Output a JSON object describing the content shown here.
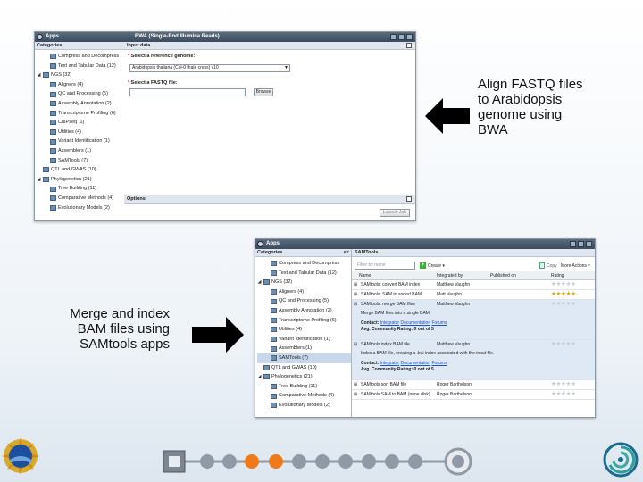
{
  "top_shot": {
    "apps_title": "Apps",
    "dialog_title": "BWA (Single-End Illumina Reads)",
    "categories_header": "Categories",
    "tree": [
      {
        "exp": "",
        "label": "Compress and Decompress",
        "indent": 1
      },
      {
        "exp": "",
        "label": "Text and Tabular Data (12)",
        "indent": 1
      },
      {
        "exp": "◢",
        "label": "NGS (32)",
        "indent": 0
      },
      {
        "exp": "",
        "label": "Aligners (4)",
        "indent": 1
      },
      {
        "exp": "",
        "label": "QC and Processing (5)",
        "indent": 1
      },
      {
        "exp": "",
        "label": "Assembly Annotation (2)",
        "indent": 1
      },
      {
        "exp": "",
        "label": "Transcriptome Profiling (6)",
        "indent": 1
      },
      {
        "exp": "",
        "label": "ChIPseq (1)",
        "indent": 1
      },
      {
        "exp": "",
        "label": "Utilities (4)",
        "indent": 1
      },
      {
        "exp": "",
        "label": "Variant Identification (1)",
        "indent": 1
      },
      {
        "exp": "",
        "label": "Assemblers (1)",
        "indent": 1
      },
      {
        "exp": "",
        "label": "SAMTools (7)",
        "indent": 1
      },
      {
        "exp": "",
        "label": "QTL and GWAS (10)",
        "indent": 0
      },
      {
        "exp": "◢",
        "label": "Phylogenetics (21)",
        "indent": 0
      },
      {
        "exp": "",
        "label": "Tree Building (11)",
        "indent": 1
      },
      {
        "exp": "",
        "label": "Comparative Methods (4)",
        "indent": 1
      },
      {
        "exp": "",
        "label": "Evolutionary Models (2)",
        "indent": 1
      }
    ],
    "input_header": "Input data",
    "ref_label": "Select a reference genome:",
    "ref_value": "Arabidopsis thaliana (Col-0 thale cress) v10",
    "fastq_label": "Select a FASTQ file:",
    "browse_label": "Browse",
    "options_header": "Options",
    "launch_label": "Launch Job"
  },
  "bottom_shot": {
    "apps_title": "Apps",
    "categories_header": "Categories",
    "collapse_label": "<<",
    "tree": [
      {
        "exp": "",
        "label": "Compress and Decompress",
        "indent": 1,
        "sel": false
      },
      {
        "exp": "",
        "label": "Text and Tabular Data (12)",
        "indent": 1,
        "sel": false
      },
      {
        "exp": "◢",
        "label": "NGS (32)",
        "indent": 0,
        "sel": false
      },
      {
        "exp": "",
        "label": "Aligners (4)",
        "indent": 1,
        "sel": false
      },
      {
        "exp": "",
        "label": "QC and Processing (5)",
        "indent": 1,
        "sel": false
      },
      {
        "exp": "",
        "label": "Assembly Annotation (2)",
        "indent": 1,
        "sel": false
      },
      {
        "exp": "",
        "label": "Transcriptome Profiling (6)",
        "indent": 1,
        "sel": false
      },
      {
        "exp": "",
        "label": "Utilities (4)",
        "indent": 1,
        "sel": false
      },
      {
        "exp": "",
        "label": "Variant Identification (1)",
        "indent": 1,
        "sel": false
      },
      {
        "exp": "",
        "label": "Assemblers (1)",
        "indent": 1,
        "sel": false
      },
      {
        "exp": "",
        "label": "SAMTools (7)",
        "indent": 1,
        "sel": true
      },
      {
        "exp": "",
        "label": "QTL and GWAS (10)",
        "indent": 0,
        "sel": false
      },
      {
        "exp": "◢",
        "label": "Phylogenetics (21)",
        "indent": 0,
        "sel": false
      },
      {
        "exp": "",
        "label": "Tree Building (11)",
        "indent": 1,
        "sel": false
      },
      {
        "exp": "",
        "label": "Comparative Methods (4)",
        "indent": 1,
        "sel": false
      },
      {
        "exp": "",
        "label": "Evolutionary Models (2)",
        "indent": 1,
        "sel": false
      }
    ],
    "panel_title": "SAMTools",
    "filter_placeholder": "Filter by name",
    "create_label": "Create ▾",
    "copy_label": "Copy",
    "more_actions_label": "More Actions ▾",
    "columns": {
      "name": "Name",
      "integrated_by": "Integrated by",
      "published_on": "Published on",
      "rating": "Rating"
    },
    "rows": [
      {
        "name": "SAMtools: convert BAM index",
        "by": "Matthew Vaughn",
        "gold": false
      },
      {
        "name": "SAMtools: SAM to sorted BAM",
        "by": "Matt Vaughn",
        "gold": true
      },
      {
        "name": "SAMtools: merge BAM files",
        "by": "Matthew Vaughn",
        "gold": false
      },
      {
        "name": "SAMtools index BAM file",
        "by": "Matthew Vaughn",
        "gold": false
      },
      {
        "name": "SAMtools sort BAM file",
        "by": "Roger Barthelson",
        "gold": false
      },
      {
        "name": "SAMtools SAM to BAM (none disk)",
        "by": "Roger Barthelson",
        "gold": false
      }
    ],
    "merge_detail": {
      "desc": "Merge BAM files into a single BAM",
      "contact": "Contact:",
      "links": [
        "Integrator",
        "Documentation",
        "Forums"
      ],
      "rating": "Avg. Community Rating: 0 out of 5"
    },
    "index_detail": {
      "desc": "Index a BAM file, creating a .bai index associated with the input file.",
      "contact": "Contact:",
      "links": [
        "Integrator",
        "Documentation",
        "Forums"
      ],
      "rating": "Avg. Community Rating: 0 out of 5"
    }
  },
  "captions": {
    "align": [
      "Align FASTQ files",
      "to Arabidopsis",
      "genome using",
      "BWA"
    ],
    "merge": [
      "Merge and index",
      "BAM files using",
      "SAMtools apps"
    ]
  },
  "colors": {
    "accent_orange": "#f07a1a",
    "nav_gray": "#8f9aa6",
    "arrow": "#000000"
  },
  "icons": {
    "nsf_logo": "nsf-seal",
    "iplant_logo": "iplant-spiral"
  }
}
